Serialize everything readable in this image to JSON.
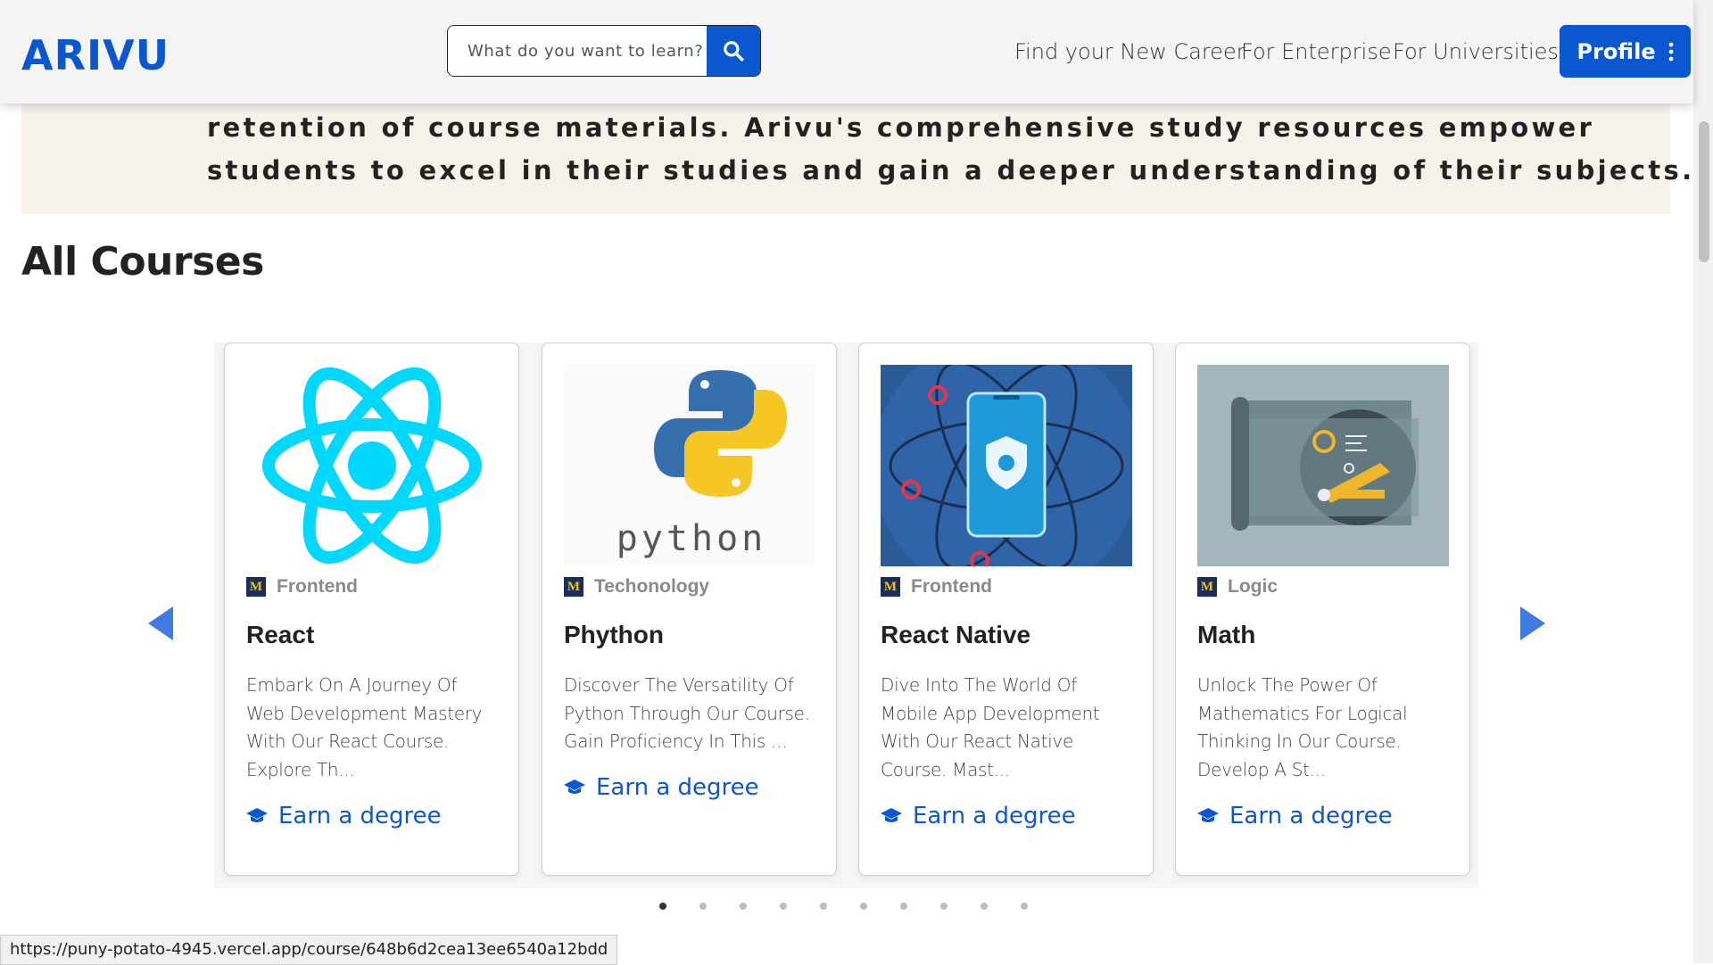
{
  "header": {
    "logo": "ARIVU",
    "search_placeholder": "What do you want to learn?",
    "nav": [
      "Find your New Career",
      "For Enterprise",
      "For Universities"
    ],
    "profile_label": "Profile"
  },
  "banner": {
    "line1": "retention of course materials. Arivu's comprehensive study resources empower",
    "line2": "students to excel in their studies and gain a deeper understanding of their subjects."
  },
  "section_title": "All Courses",
  "courses": [
    {
      "category": "Frontend",
      "title": "React",
      "description": "Embark On A Journey Of Web Development Mastery With Our React Course. Explore Th...",
      "link": "Earn a degree",
      "image_icon": "react-logo-icon"
    },
    {
      "category": "Techonology",
      "title": "Phython",
      "description": "Discover The Versatility Of Python Through Our Course. Gain Proficiency In This ...",
      "link": "Earn a degree",
      "image_icon": "python-logo-icon",
      "image_text": "python"
    },
    {
      "category": "Frontend",
      "title": "React Native",
      "description": "Dive Into The World Of Mobile App Development With Our React Native Course. Mast...",
      "link": "Earn a degree",
      "image_icon": "mobile-app-icon"
    },
    {
      "category": "Logic",
      "title": "Math",
      "description": "Unlock The Power Of Mathematics For Logical Thinking In Our Course. Develop A St...",
      "link": "Earn a degree",
      "image_icon": "math-blueprint-icon"
    }
  ],
  "pagination": {
    "total": 10,
    "active": 1
  },
  "status_url": "https://puny-potato-4945.vercel.app/course/648b6d2cea13ee6540a12bdd",
  "colors": {
    "accent": "#0b57d0",
    "banner_bg": "#f6f2ea",
    "react_cyan": "#00d8ff"
  }
}
